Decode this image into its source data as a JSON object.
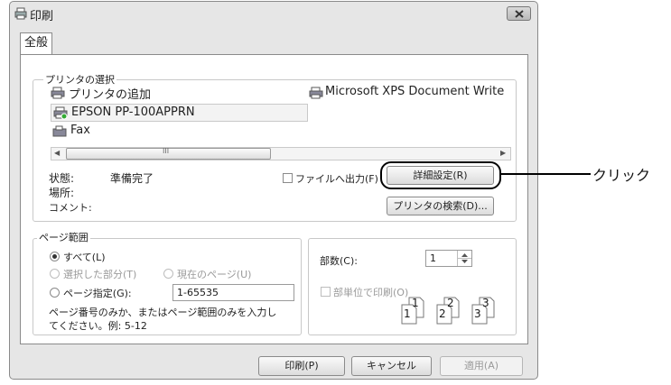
{
  "window": {
    "title": "印刷"
  },
  "tabs": [
    {
      "label": "全般"
    }
  ],
  "printer_group": {
    "legend": "プリンタの選択",
    "items": [
      {
        "label": "プリンタの追加",
        "icon": "add-printer-icon"
      },
      {
        "label": "Microsoft XPS Document Write",
        "icon": "printer-icon"
      },
      {
        "label": "EPSON PP-100APPRN",
        "icon": "printer-icon",
        "selected": true
      },
      {
        "label": "Fax",
        "icon": "fax-icon"
      }
    ],
    "scrollbar_thumb_glyph": "III"
  },
  "status": {
    "state_label": "状態:",
    "state_value": "準備完了",
    "location_label": "場所:",
    "comment_label": "コメント:"
  },
  "print_to_file_label": "ファイルへ出力(F)",
  "buttons": {
    "details": "詳細設定(R)",
    "find_printer": "プリンタの検索(D)...",
    "print": "印刷(P)",
    "cancel": "キャンセル",
    "apply": "適用(A)"
  },
  "annotation": {
    "label": "クリック"
  },
  "page_range": {
    "legend": "ページ範囲",
    "all": "すべて(L)",
    "selection": "選択した部分(T)",
    "current": "現在のページ(U)",
    "pages": "ページ指定(G):",
    "pages_value": "1-65535",
    "hint_line1": "ページ番号のみか、またはページ範囲のみを入力し",
    "hint_line2": "てください。例: 5-12",
    "selected": "all"
  },
  "copies": {
    "label": "部数(C):",
    "value": "1",
    "collate_label": "部単位で印刷(O)",
    "collate_icon_digits": [
      "1",
      "1",
      "2",
      "2",
      "3",
      "3"
    ]
  },
  "colors": {
    "accent": "#000000",
    "window_bg": "#e6e6e6",
    "close_button": "#c8c8c8"
  }
}
